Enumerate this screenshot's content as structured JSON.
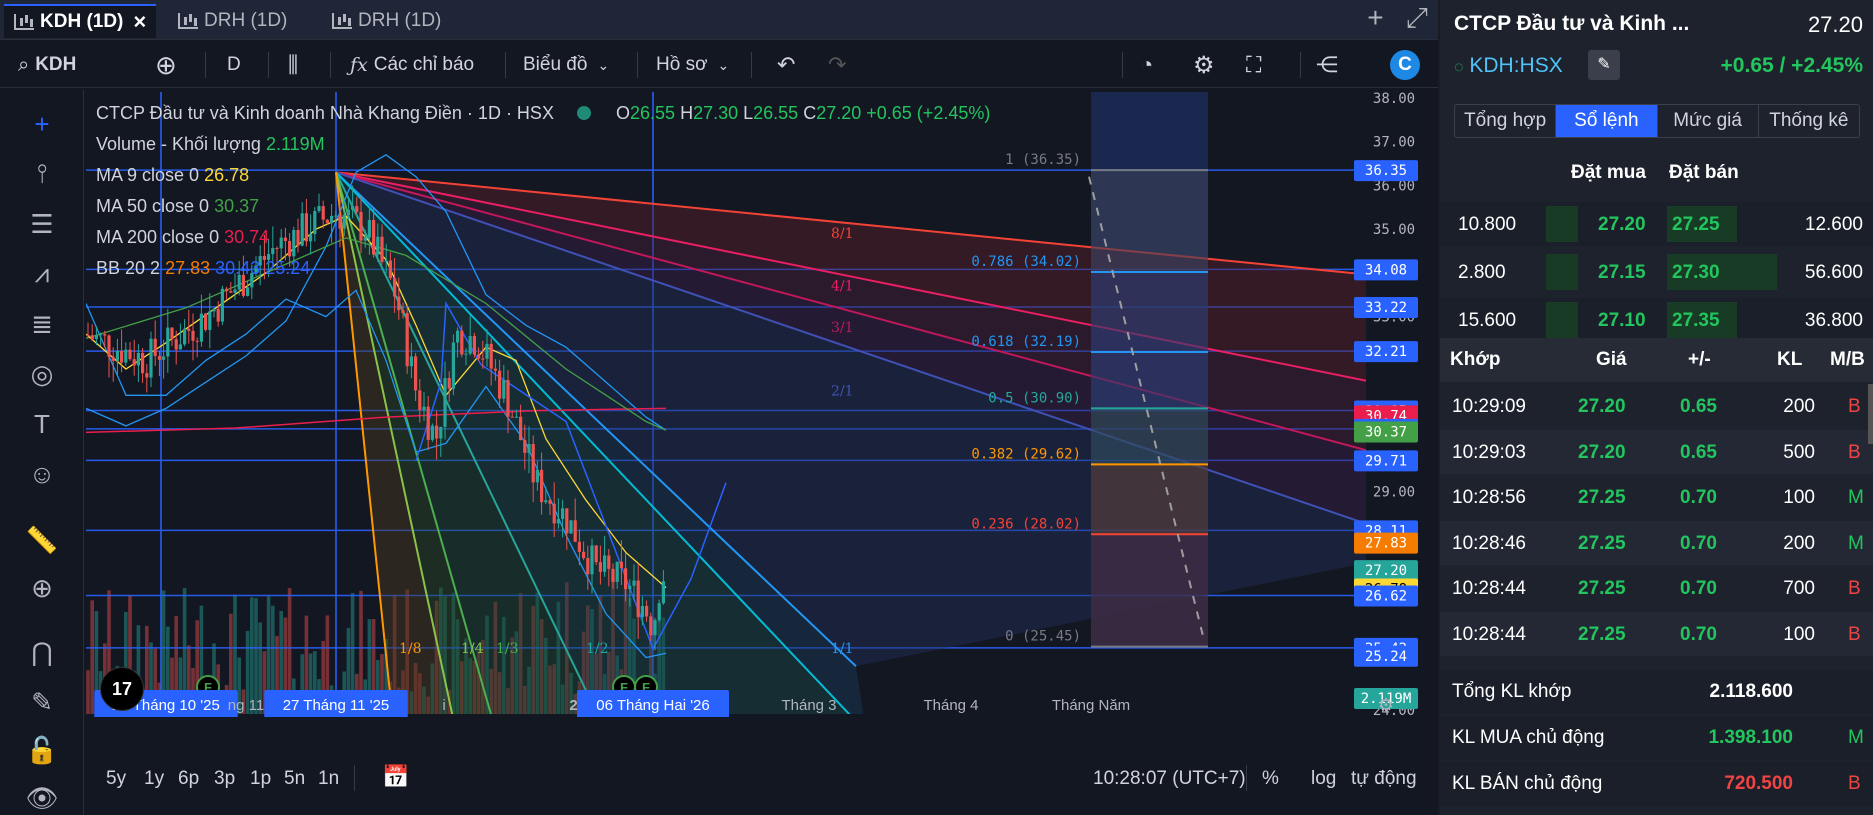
{
  "tabs": [
    {
      "label": "KDH (1D)",
      "active": true
    },
    {
      "label": "DRH (1D)"
    },
    {
      "label": "DRH (1D)"
    }
  ],
  "toolbar": {
    "symbol": "KDH",
    "interval": "D",
    "indicators": "Các chỉ báo",
    "chart_type": "Biểu đồ",
    "profile": "Hồ sơ"
  },
  "legend": {
    "title": "CTCP Đầu tư và Kinh doanh Nhà Khang Điền · 1D · HSX",
    "o_label": "O",
    "o": "26.55",
    "h_label": "H",
    "h": "27.30",
    "l_label": "L",
    "l": "26.55",
    "c_label": "C",
    "c": "27.20",
    "chg": "+0.65 (+2.45%)",
    "volume_label": "Volume - Khối lượng",
    "volume": "2.119M",
    "ma9_label": "MA 9 close 0",
    "ma9": "26.78",
    "ma50_label": "MA 50 close 0",
    "ma50": "30.37",
    "ma200_label": "MA 200 close 0",
    "ma200": "30.74",
    "bb_label": "BB 20 2",
    "bb1": "27.83",
    "bb2": "30.43",
    "bb3": "25.24"
  },
  "chart_data": {
    "type": "candlestick",
    "ylim": [
      24.0,
      38.0
    ],
    "y_ticks": [
      "38.00",
      "37.00",
      "36.00",
      "35.00",
      "33.00",
      "29.00",
      "24.00"
    ],
    "fib_levels": [
      {
        "label": "1 (36.35)",
        "value": 36.35
      },
      {
        "label": "0.786 (34.02)",
        "value": 34.02
      },
      {
        "label": "0.618 (32.19)",
        "value": 32.19
      },
      {
        "label": "0.5 (30.90)",
        "value": 30.9
      },
      {
        "label": "0.382 (29.62)",
        "value": 29.62
      },
      {
        "label": "0.236 (28.02)",
        "value": 28.02
      },
      {
        "label": "0 (25.45)",
        "value": 25.45
      }
    ],
    "gann_labels": [
      "8/1",
      "4/1",
      "3/1",
      "2/1",
      "1/1",
      "1/8",
      "1/4",
      "1/3",
      "1/2"
    ],
    "price_badges": [
      {
        "v": "36.35",
        "c": "#2962ff"
      },
      {
        "v": "34.08",
        "c": "#2962ff"
      },
      {
        "v": "33.22",
        "c": "#2962ff"
      },
      {
        "v": "32.21",
        "c": "#2962ff"
      },
      {
        "v": "30.85",
        "c": "#2962ff"
      },
      {
        "v": "30.74",
        "c": "#e91e4d"
      },
      {
        "v": "30.43",
        "c": "#2962ff"
      },
      {
        "v": "30.37",
        "c": "#43a047"
      },
      {
        "v": "29.71",
        "c": "#2962ff"
      },
      {
        "v": "28.11",
        "c": "#2962ff"
      },
      {
        "v": "27.83",
        "c": "#f57c00"
      },
      {
        "v": "27.20",
        "c": "#26a69a"
      },
      {
        "v": "26.78",
        "c": "#fdd835"
      },
      {
        "v": "26.62",
        "c": "#2962ff"
      },
      {
        "v": "25.42",
        "c": "#2962ff"
      },
      {
        "v": "25.24",
        "c": "#2962ff"
      },
      {
        "v": "2.119M",
        "c": "#26a69a"
      }
    ],
    "x_labels": [
      "21 Tháng 10 '25",
      "ng 11",
      "27 Tháng 11 '25",
      "i",
      "2026",
      "06 Tháng Hai '26",
      "Tháng 3",
      "Tháng 4",
      "Tháng Năm"
    ]
  },
  "bottom": {
    "ranges": [
      "5y",
      "1y",
      "6p",
      "3p",
      "1p",
      "5n",
      "1n"
    ],
    "time": "10:28:07 (UTC+7)",
    "pct": "%",
    "log": "log",
    "auto": "tự động"
  },
  "right": {
    "name": "CTCP Đầu tư và Kinh ...",
    "price": "27.20",
    "ticker": "KDH:HSX",
    "change": "+0.65 / +2.45%",
    "tabs": [
      "Tổng hợp",
      "Sổ lệnh",
      "Mức giá",
      "Thống kê"
    ],
    "ob_head": {
      "buy": "Đặt mua",
      "sell": "Đặt bán"
    },
    "orderbook": [
      {
        "bq": "10.800",
        "bp": "27.20",
        "sp": "27.25",
        "sq": "12.600"
      },
      {
        "bq": "2.800",
        "bp": "27.15",
        "sp": "27.30",
        "sq": "56.600"
      },
      {
        "bq": "15.600",
        "bp": "27.10",
        "sp": "27.35",
        "sq": "36.800"
      }
    ],
    "trade_head": {
      "time": "Khớp",
      "price": "Giá",
      "chg": "+/-",
      "vol": "KL",
      "side": "M/B"
    },
    "trades": [
      {
        "t": "10:29:09",
        "p": "27.20",
        "c": "0.65",
        "v": "200",
        "s": "B"
      },
      {
        "t": "10:29:03",
        "p": "27.20",
        "c": "0.65",
        "v": "500",
        "s": "B"
      },
      {
        "t": "10:28:56",
        "p": "27.25",
        "c": "0.70",
        "v": "100",
        "s": "M"
      },
      {
        "t": "10:28:46",
        "p": "27.25",
        "c": "0.70",
        "v": "200",
        "s": "M"
      },
      {
        "t": "10:28:44",
        "p": "27.25",
        "c": "0.70",
        "v": "700",
        "s": "B"
      },
      {
        "t": "10:28:44",
        "p": "27.25",
        "c": "0.70",
        "v": "100",
        "s": "B"
      }
    ],
    "summary": [
      {
        "label": "Tổng KL khớp",
        "value": "2.118.600",
        "side": ""
      },
      {
        "label": "KL MUA chủ động",
        "value": "1.398.100",
        "side": "M"
      },
      {
        "label": "KL BÁN chủ động",
        "value": "720.500",
        "side": "B"
      }
    ]
  }
}
